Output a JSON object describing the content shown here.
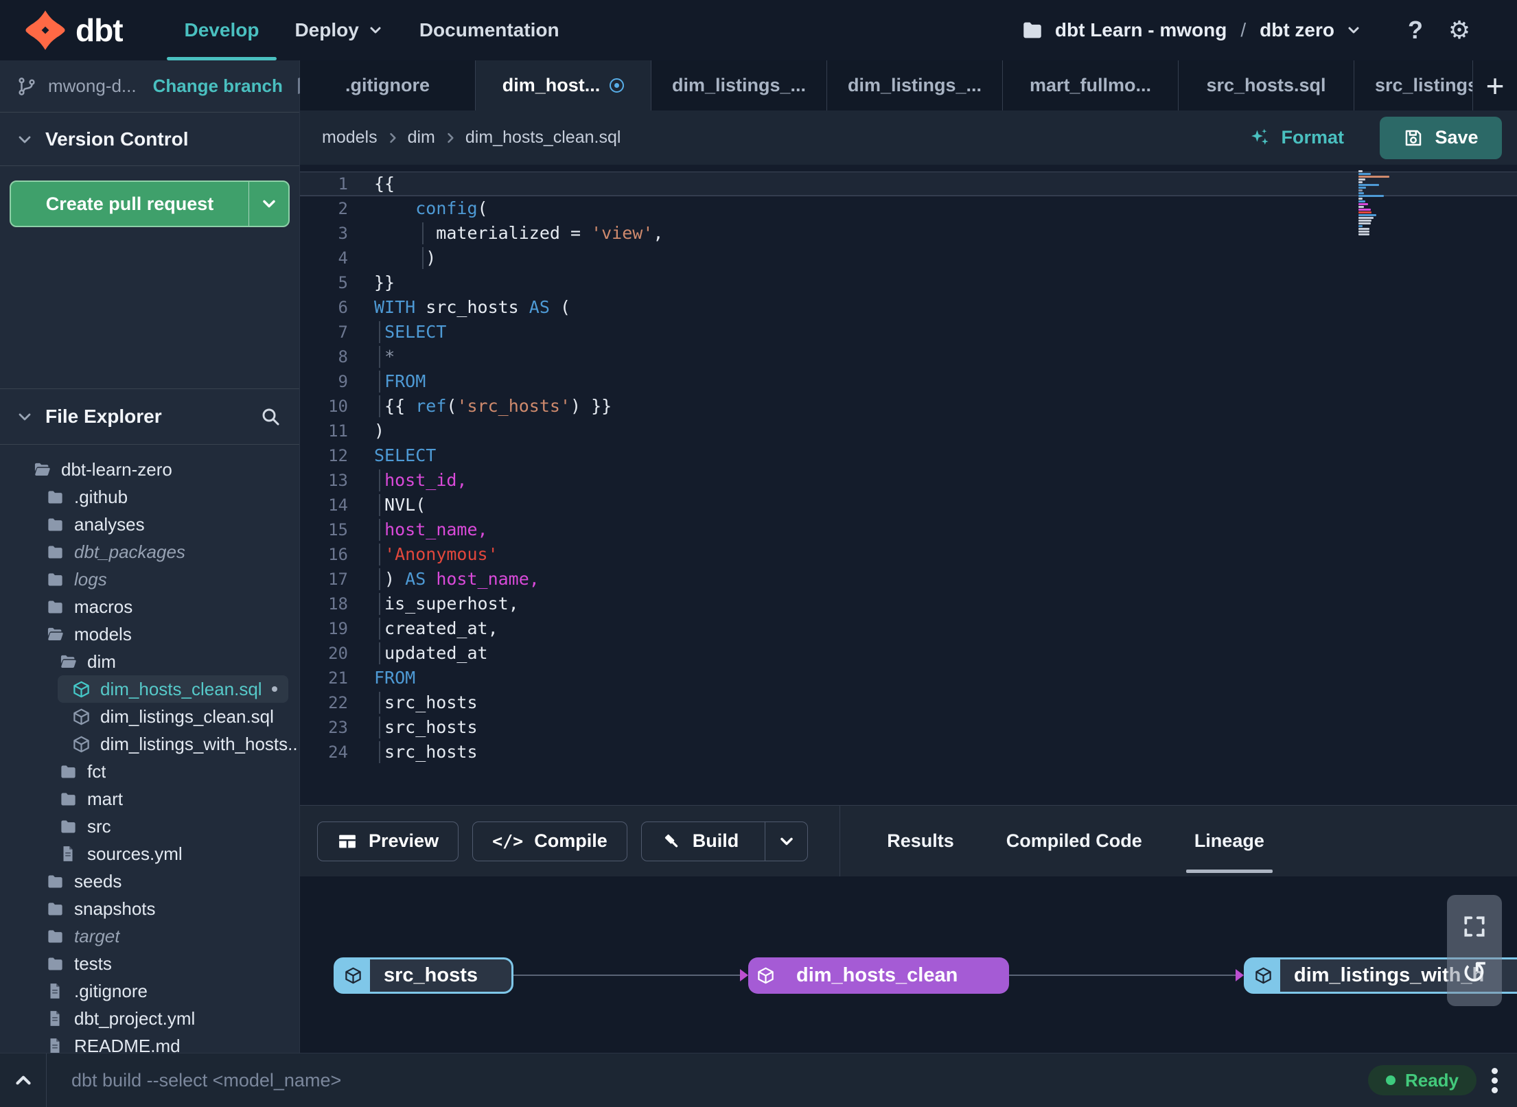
{
  "topbar": {
    "brand": "dbt",
    "nav": [
      {
        "label": "Develop",
        "active": true
      },
      {
        "label": "Deploy",
        "caret": true
      },
      {
        "label": "Documentation"
      }
    ],
    "account": "dbt Learn - mwong",
    "separator": "/",
    "project": "dbt zero",
    "help_label": "?",
    "gear_label": "⚙"
  },
  "sidebar": {
    "branch_name": "mwong-d...",
    "change_branch": "Change branch",
    "version_control": "Version Control",
    "create_pull_request": "Create pull request",
    "file_explorer": "File Explorer",
    "tree": [
      {
        "label": "dbt-learn-zero",
        "type": "folder-open",
        "level": 0
      },
      {
        "label": ".github",
        "type": "folder",
        "level": 1
      },
      {
        "label": "analyses",
        "type": "folder",
        "level": 1
      },
      {
        "label": "dbt_packages",
        "type": "folder",
        "level": 1,
        "italic": true
      },
      {
        "label": "logs",
        "type": "folder",
        "level": 1,
        "italic": true
      },
      {
        "label": "macros",
        "type": "folder",
        "level": 1
      },
      {
        "label": "models",
        "type": "folder-open",
        "level": 1
      },
      {
        "label": "dim",
        "type": "folder-open",
        "level": 2
      },
      {
        "label": "dim_hosts_clean.sql",
        "type": "model",
        "level": 3,
        "selected": true,
        "modified": true
      },
      {
        "label": "dim_listings_clean.sql",
        "type": "model",
        "level": 3
      },
      {
        "label": "dim_listings_with_hosts...",
        "type": "model",
        "level": 3
      },
      {
        "label": "fct",
        "type": "folder",
        "level": 2
      },
      {
        "label": "mart",
        "type": "folder",
        "level": 2
      },
      {
        "label": "src",
        "type": "folder",
        "level": 2
      },
      {
        "label": "sources.yml",
        "type": "file",
        "level": 2
      },
      {
        "label": "seeds",
        "type": "folder",
        "level": 1
      },
      {
        "label": "snapshots",
        "type": "folder",
        "level": 1
      },
      {
        "label": "target",
        "type": "folder",
        "level": 1,
        "italic": true
      },
      {
        "label": "tests",
        "type": "folder",
        "level": 1
      },
      {
        "label": ".gitignore",
        "type": "file",
        "level": 1
      },
      {
        "label": "dbt_project.yml",
        "type": "file",
        "level": 1
      },
      {
        "label": "README.md",
        "type": "file",
        "level": 1
      }
    ]
  },
  "editor": {
    "tabs": [
      {
        "label": ".gitignore"
      },
      {
        "label": "dim_host...",
        "active": true,
        "modified": true
      },
      {
        "label": "dim_listings_..."
      },
      {
        "label": "dim_listings_..."
      },
      {
        "label": "mart_fullmo..."
      },
      {
        "label": "src_hosts.sql"
      },
      {
        "label": "src_listings.",
        "clip": true
      }
    ],
    "breadcrumb": [
      "models",
      "dim",
      "dim_hosts_clean.sql"
    ],
    "format_label": "Format",
    "save_label": "Save",
    "lines": [
      {
        "n": 1,
        "cur": true,
        "t": [
          [
            "p",
            "{{"
          ]
        ]
      },
      {
        "n": 2,
        "t": [
          [
            "p",
            "    "
          ],
          [
            "fn",
            "config"
          ],
          [
            "p",
            "("
          ]
        ]
      },
      {
        "n": 3,
        "g": 70,
        "t": [
          [
            "p",
            "      materialized = "
          ],
          [
            "so",
            "'view'"
          ],
          [
            "p",
            ","
          ]
        ]
      },
      {
        "n": 4,
        "g": 70,
        "t": [
          [
            "p",
            "     )"
          ]
        ]
      },
      {
        "n": 5,
        "t": [
          [
            "p",
            "}}"
          ]
        ]
      },
      {
        "n": 6,
        "t": [
          [
            "kw",
            "WITH"
          ],
          [
            "p",
            " src_hosts "
          ],
          [
            "kw",
            "AS"
          ],
          [
            "p",
            " ("
          ]
        ]
      },
      {
        "n": 7,
        "g": 7,
        "t": [
          [
            "p",
            " "
          ],
          [
            "kw",
            "SELECT"
          ]
        ]
      },
      {
        "n": 8,
        "g": 7,
        "t": [
          [
            "p",
            " "
          ],
          [
            "op",
            "*"
          ]
        ]
      },
      {
        "n": 9,
        "g": 7,
        "t": [
          [
            "p",
            " "
          ],
          [
            "kw",
            "FROM"
          ]
        ]
      },
      {
        "n": 10,
        "g": 7,
        "t": [
          [
            "p",
            " {{ "
          ],
          [
            "fn",
            "ref"
          ],
          [
            "p",
            "("
          ],
          [
            "so",
            "'src_hosts'"
          ],
          [
            "p",
            ") }}"
          ]
        ]
      },
      {
        "n": 11,
        "t": [
          [
            "p",
            ")"
          ]
        ]
      },
      {
        "n": 12,
        "t": [
          [
            "kw",
            "SELECT"
          ]
        ]
      },
      {
        "n": 13,
        "g": 7,
        "t": [
          [
            "p",
            " "
          ],
          [
            "col",
            "host_id,"
          ]
        ]
      },
      {
        "n": 14,
        "g": 7,
        "t": [
          [
            "p",
            " NVL("
          ]
        ]
      },
      {
        "n": 15,
        "g": 7,
        "t": [
          [
            "p",
            " "
          ],
          [
            "col",
            "host_name,"
          ]
        ]
      },
      {
        "n": 16,
        "g": 7,
        "t": [
          [
            "p",
            " "
          ],
          [
            "sr",
            "'Anonymous'"
          ]
        ]
      },
      {
        "n": 17,
        "g": 7,
        "t": [
          [
            "p",
            " ) "
          ],
          [
            "kw",
            "AS"
          ],
          [
            "p",
            " "
          ],
          [
            "col",
            "host_name,"
          ]
        ]
      },
      {
        "n": 18,
        "g": 7,
        "t": [
          [
            "p",
            " is_superhost,"
          ]
        ]
      },
      {
        "n": 19,
        "g": 7,
        "t": [
          [
            "p",
            " created_at,"
          ]
        ]
      },
      {
        "n": 20,
        "g": 7,
        "t": [
          [
            "p",
            " updated_at"
          ]
        ]
      },
      {
        "n": 21,
        "t": [
          [
            "kw",
            "FROM"
          ]
        ]
      },
      {
        "n": 22,
        "g": 7,
        "t": [
          [
            "p",
            " src_hosts"
          ]
        ]
      },
      {
        "n": 23,
        "g": 7,
        "t": [
          [
            "p",
            " src_hosts"
          ]
        ]
      },
      {
        "n": 24,
        "g": 7,
        "t": [
          [
            "p",
            " src_hosts"
          ]
        ]
      }
    ]
  },
  "panel": {
    "preview": "Preview",
    "compile": "Compile",
    "build": "Build",
    "tabs": [
      {
        "label": "Results"
      },
      {
        "label": "Compiled Code"
      },
      {
        "label": "Lineage",
        "active": true
      }
    ]
  },
  "lineage": {
    "nodes": [
      {
        "label": "src_hosts",
        "kind": "source"
      },
      {
        "label": "dim_hosts_clean",
        "kind": "model"
      },
      {
        "label": "dim_listings_with_h",
        "kind": "source"
      }
    ]
  },
  "statusbar": {
    "command": "dbt build --select <model_name>",
    "status": "Ready"
  },
  "colors": {
    "accent_teal": "#4AC0C0",
    "green_button": "#3FA06B",
    "save_button": "#2C6967",
    "selected_file_teal": "#56C9C9",
    "tab_modified_blue": "#58AEE8",
    "code_keyword_blue": "#4E9AD5",
    "code_string_orange": "#CF8A6D",
    "code_string_red": "#E2473C",
    "code_column_magenta": "#D94AD9",
    "node_source_blue": "#7FC7E9",
    "node_model_purple": "#A55BD5",
    "edge_arrow_purple": "#BC4FD0",
    "ready_green": "#43CA7C",
    "logo_orange": "#FF6945"
  }
}
